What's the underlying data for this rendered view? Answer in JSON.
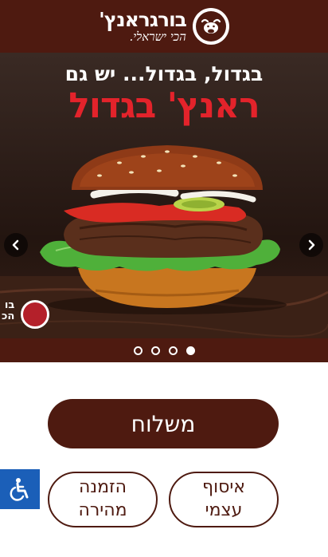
{
  "header": {
    "logo_name": "בורגראנץ'",
    "logo_tagline": "הכי ישראלי."
  },
  "carousel": {
    "headline_sub": "בגדול, בגדול... יש גם",
    "headline_main": "ראנץ' בגדול",
    "corner_logo_text": "בו\nהכ",
    "prev_icon": "chevron-left-icon",
    "next_icon": "chevron-right-icon",
    "slide_count": 4,
    "active_slide": 4
  },
  "actions": {
    "delivery_label": "משלוח",
    "pickup_line1": "איסוף",
    "pickup_line2": "עצמי",
    "quick_line1": "הזמנה",
    "quick_line2": "מהירה"
  },
  "accessibility": {
    "icon": "wheelchair-icon"
  },
  "colors": {
    "brand_brown": "#4e1a10",
    "headline_red": "#e3232b",
    "accessibility_blue": "#1b5fb8"
  }
}
